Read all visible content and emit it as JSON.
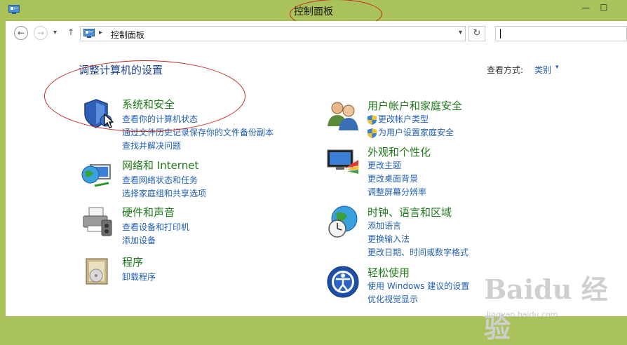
{
  "window": {
    "title": "控制面板",
    "controls": {
      "minimize": "—",
      "maximize": "☐"
    }
  },
  "nav": {
    "back": "←",
    "forward": "→",
    "dropdown": "▾",
    "up": "↑",
    "breadcrumb_sep": "▸",
    "address": "控制面板",
    "address_dropdown": "▾",
    "refresh": "↻",
    "search_placeholder": ""
  },
  "page": {
    "heading": "调整计算机的设置",
    "view_by_label": "查看方式:",
    "view_by_value": "类别",
    "view_by_caret": "▾"
  },
  "categories_left": [
    {
      "icon": "shield-security-icon",
      "title": "系统和安全",
      "links": [
        "查看你的计算机状态",
        "通过文件历史记录保存你的文件备份副本",
        "查找并解决问题"
      ]
    },
    {
      "icon": "network-globe-icon",
      "title": "网络和 Internet",
      "links": [
        "查看网络状态和任务",
        "选择家庭组和共享选项"
      ]
    },
    {
      "icon": "printer-icon",
      "title": "硬件和声音",
      "links": [
        "查看设备和打印机",
        "添加设备"
      ]
    },
    {
      "icon": "programs-icon",
      "title": "程序",
      "links": [
        "卸载程序"
      ]
    }
  ],
  "categories_right": [
    {
      "icon": "users-icon",
      "title": "用户帐户和家庭安全",
      "links": [
        "更改帐户类型",
        "为用户设置家庭安全"
      ]
    },
    {
      "icon": "display-paint-icon",
      "title": "外观和个性化",
      "links": [
        "更改主题",
        "更改桌面背景",
        "调整屏幕分辨率"
      ]
    },
    {
      "icon": "clock-globe-icon",
      "title": "时钟、语言和区域",
      "links": [
        "添加语言",
        "更换输入法",
        "更改日期、时间或数字格式"
      ]
    },
    {
      "icon": "accessibility-icon",
      "title": "轻松使用",
      "links": [
        "使用 Windows 建议的设置",
        "优化视觉显示"
      ]
    }
  ],
  "watermark": {
    "text": "Baidu 经验",
    "sub": "jingyan.baidu.com"
  },
  "colors": {
    "frame": "#a9c35a",
    "category_title": "#1f7a1a",
    "link": "#1f5fb4",
    "heading": "#1b3f8f",
    "annotation": "#c4281f"
  }
}
